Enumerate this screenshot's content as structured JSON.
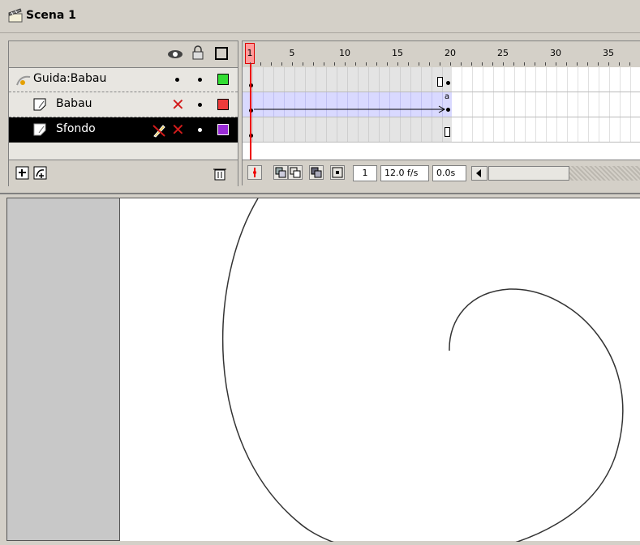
{
  "scene": {
    "label": "Scena 1",
    "icon": "clapperboard-icon"
  },
  "timeline": {
    "header_icons": [
      "eye-icon",
      "lock-icon",
      "outline-square-icon"
    ],
    "ruler_numbers": [
      "1",
      "5",
      "10",
      "15",
      "20",
      "25",
      "30",
      "35"
    ],
    "layers": [
      {
        "name": "Guida:Babau",
        "icon": "motion-guide-icon",
        "visible_mark": "dot",
        "lock_mark": "dot",
        "outline_color": "#33dd33",
        "selected": false
      },
      {
        "name": "Babau",
        "icon": "layer-icon",
        "visible_mark": "x",
        "lock_mark": "dot",
        "outline_color": "#ee3b3b",
        "selected": false
      },
      {
        "name": "Sfondo",
        "icon": "layer-icon",
        "pencil": true,
        "visible_mark": "x",
        "lock_mark": "dot",
        "outline_color": "#9a2cd6",
        "selected": true
      }
    ],
    "footer": {
      "current_frame": "1",
      "frame_rate": "12.0 f/s",
      "elapsed": "0.0s"
    },
    "colors": {
      "playhead": "#e00000",
      "motion_tween": "#d9d9ff"
    }
  }
}
